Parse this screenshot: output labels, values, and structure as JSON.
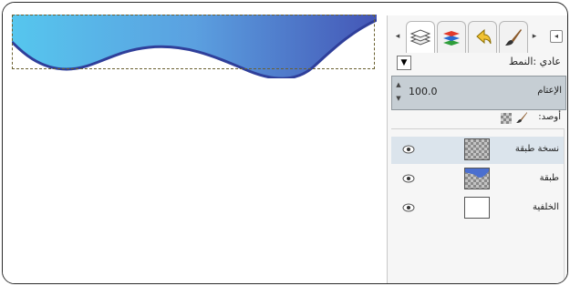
{
  "layers_panel": {
    "mode_label": "عادي :النمط",
    "opacity_label": "الإعتام",
    "opacity_value": "100.0",
    "lock_label": "أوصد:",
    "layers": [
      {
        "name": "نسخة طبقة",
        "thumb": "checker",
        "active": true
      },
      {
        "name": "طبقة",
        "thumb": "wave"
      },
      {
        "name": "الخلفية",
        "thumb": "white"
      }
    ]
  },
  "icons": [
    "layers-tab-icon",
    "channels-tab-icon",
    "undo-history-tab-icon",
    "brushes-tab-icon",
    "eye-icon",
    "lock-pixels-icon",
    "lock-brush-icon"
  ],
  "colors": {
    "wave_light": "#4fc1ea",
    "wave_dark": "#3d4fb0",
    "panel_bg": "#f6f6f6",
    "opacity_bg": "#c6ced4"
  }
}
